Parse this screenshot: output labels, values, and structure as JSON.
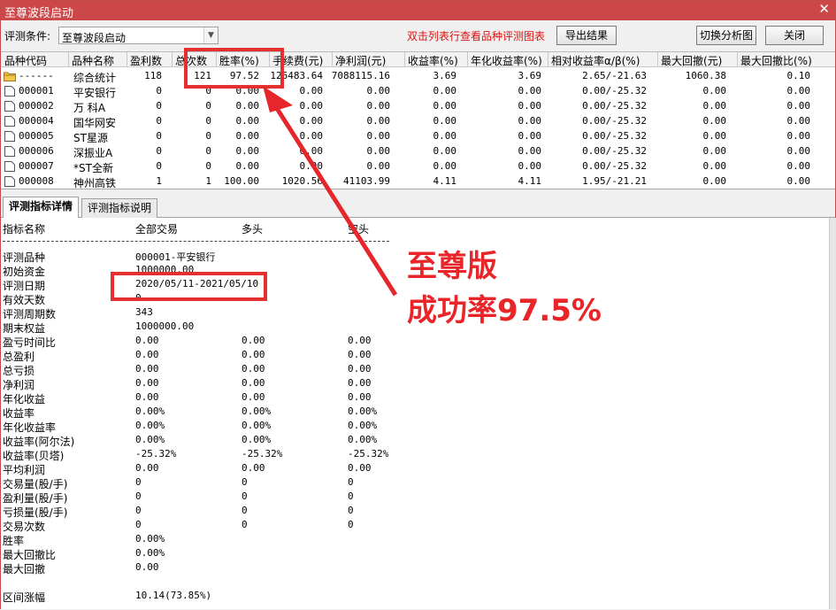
{
  "window": {
    "title": "至尊波段启动",
    "close_glyph": "✕"
  },
  "toolbar": {
    "condition_label": "评测条件:",
    "condition_value": "至尊波段启动",
    "hint": "双击列表行查看品种评测图表",
    "export_button": "导出结果",
    "switch_button": "切换分析图",
    "close_button": "关闭"
  },
  "grid": {
    "columns": [
      "品种代码",
      "品种名称",
      "盈利数",
      "总次数",
      "胜率(%)",
      "手续费(元)",
      "净利润(元)",
      "收益率(%)",
      "年化收益率(%)",
      "相对收益率α/β(%)",
      "最大回撤(元)",
      "最大回撤比(%)"
    ],
    "rows": [
      [
        "------",
        "综合统计",
        "118",
        "121",
        "97.52",
        "126483.64",
        "7088115.16",
        "3.69",
        "3.69",
        "2.65/-21.63",
        "1060.38",
        "0.10"
      ],
      [
        "000001",
        "平安银行",
        "0",
        "0",
        "0.00",
        "0.00",
        "0.00",
        "0.00",
        "0.00",
        "0.00/-25.32",
        "0.00",
        "0.00"
      ],
      [
        "000002",
        "万 科A",
        "0",
        "0",
        "0.00",
        "0.00",
        "0.00",
        "0.00",
        "0.00",
        "0.00/-25.32",
        "0.00",
        "0.00"
      ],
      [
        "000004",
        "国华网安",
        "0",
        "0",
        "0.00",
        "0.00",
        "0.00",
        "0.00",
        "0.00",
        "0.00/-25.32",
        "0.00",
        "0.00"
      ],
      [
        "000005",
        "ST星源",
        "0",
        "0",
        "0.00",
        "0.00",
        "0.00",
        "0.00",
        "0.00",
        "0.00/-25.32",
        "0.00",
        "0.00"
      ],
      [
        "000006",
        "深振业A",
        "0",
        "0",
        "0.00",
        "0.00",
        "0.00",
        "0.00",
        "0.00",
        "0.00/-25.32",
        "0.00",
        "0.00"
      ],
      [
        "000007",
        "*ST全新",
        "0",
        "0",
        "0.00",
        "0.00",
        "0.00",
        "0.00",
        "0.00",
        "0.00/-25.32",
        "0.00",
        "0.00"
      ],
      [
        "000008",
        "神州高铁",
        "1",
        "1",
        "100.00",
        "1020.56",
        "41103.99",
        "4.11",
        "4.11",
        "1.95/-21.21",
        "0.00",
        "0.00"
      ]
    ]
  },
  "tabs": [
    "评测指标详情",
    "评测指标说明"
  ],
  "detail": {
    "headers": [
      "指标名称",
      "全部交易",
      "多头",
      "空头"
    ],
    "rows": [
      [
        "评测品种",
        "000001-平安银行",
        "",
        ""
      ],
      [
        "初始资金",
        "1000000.00",
        "",
        ""
      ],
      [
        "评测日期",
        "2020/05/11-2021/05/10",
        "",
        ""
      ],
      [
        "有效天数",
        "0",
        "",
        ""
      ],
      [
        "评测周期数",
        "343",
        "",
        ""
      ],
      [
        "期末权益",
        "1000000.00",
        "",
        ""
      ],
      [
        "盈亏时间比",
        "0.00",
        "0.00",
        "0.00"
      ],
      [
        "总盈利",
        "0.00",
        "0.00",
        "0.00"
      ],
      [
        "总亏损",
        "0.00",
        "0.00",
        "0.00"
      ],
      [
        "净利润",
        "0.00",
        "0.00",
        "0.00"
      ],
      [
        "年化收益",
        "0.00",
        "0.00",
        "0.00"
      ],
      [
        "收益率",
        "0.00%",
        "0.00%",
        "0.00%"
      ],
      [
        "年化收益率",
        "0.00%",
        "0.00%",
        "0.00%"
      ],
      [
        "收益率(阿尔法)",
        "0.00%",
        "0.00%",
        "0.00%"
      ],
      [
        "收益率(贝塔)",
        "-25.32%",
        "-25.32%",
        "-25.32%"
      ],
      [
        "平均利润",
        "0.00",
        "0.00",
        "0.00"
      ],
      [
        "交易量(股/手)",
        "0",
        "0",
        "0"
      ],
      [
        "盈利量(股/手)",
        "0",
        "0",
        "0"
      ],
      [
        "亏损量(股/手)",
        "0",
        "0",
        "0"
      ],
      [
        "交易次数",
        "0",
        "0",
        "0"
      ],
      [
        "胜率",
        "0.00%",
        "",
        ""
      ],
      [
        "最大回撤比",
        "0.00%",
        "",
        ""
      ],
      [
        "最大回撤",
        "0.00",
        "",
        ""
      ],
      [
        "",
        "",
        "",
        ""
      ],
      [
        "区间涨幅",
        "10.14(73.85%)",
        "",
        ""
      ]
    ]
  },
  "annotation": {
    "line1": "至尊版",
    "line2": "成功率97.5%",
    "color": "#e8262a"
  }
}
